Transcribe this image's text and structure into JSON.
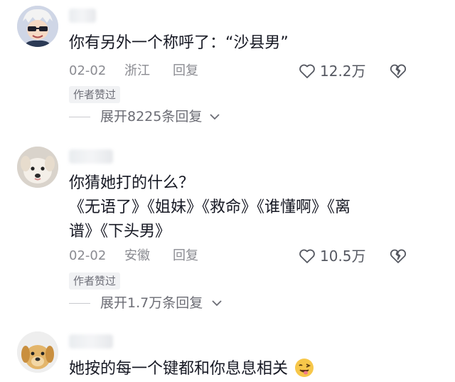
{
  "comments": [
    {
      "text": "你有另外一个称呼了：“沙县男”",
      "date": "02-02",
      "region": "浙江",
      "reply_label": "回复",
      "likes": "12.2万",
      "author_badge": "作者赞过",
      "expand_label": "展开8225条回复"
    },
    {
      "text": "你猜她打的什么？\n《无语了》《姐妹》《救命》《谁懂啊》《离\n谱》《下头男》",
      "date": "02-02",
      "region": "安徽",
      "reply_label": "回复",
      "likes": "10.5万",
      "author_badge": "作者赞过",
      "expand_label": "展开1.7万条回复"
    },
    {
      "text": "她按的每一个键都和你息息相关"
    }
  ],
  "colors": {
    "text_primary": "#161823",
    "text_secondary": "#8a8b91",
    "badge_bg": "#f1f2f4"
  },
  "icons": [
    "heart-outline-icon",
    "broken-heart-icon",
    "chevron-down-icon",
    "wink-tongue-emoji-icon"
  ]
}
